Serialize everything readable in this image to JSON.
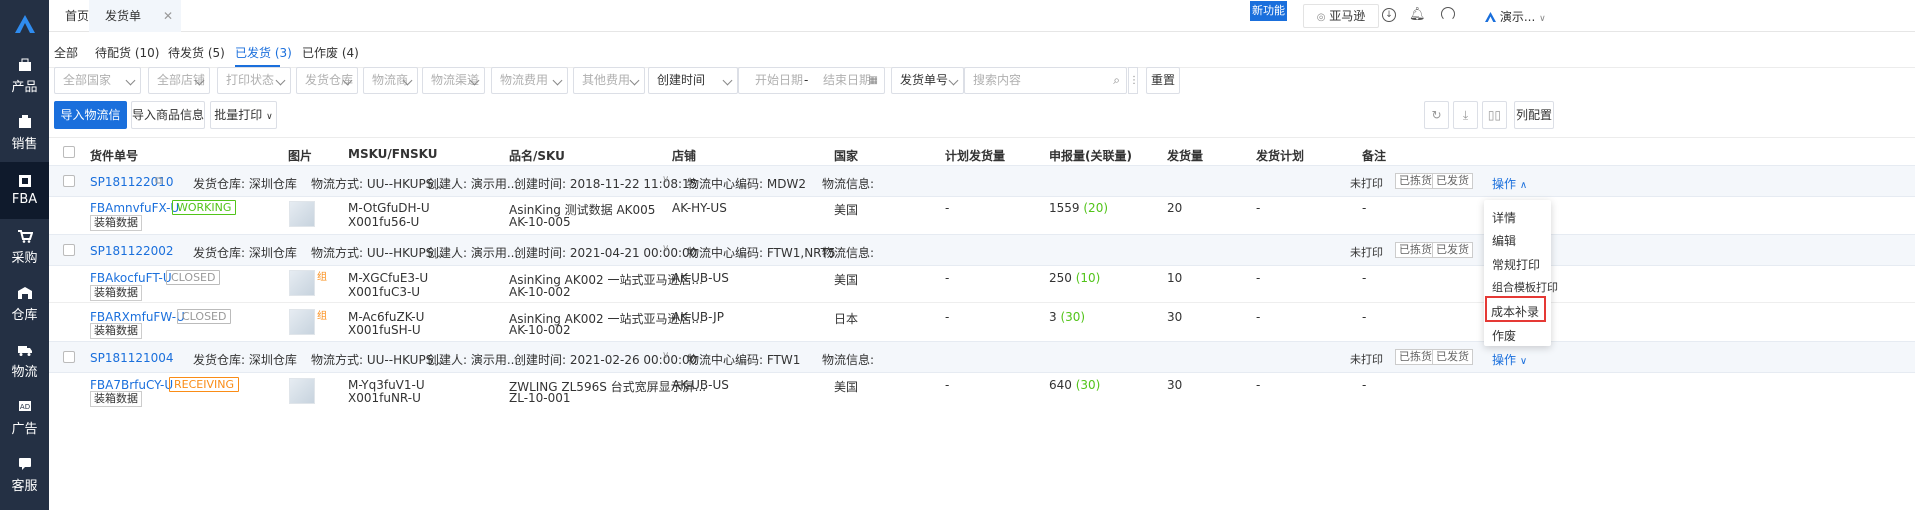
{
  "sidebar": {
    "items": [
      {
        "label": "产品",
        "icon": "product-icon"
      },
      {
        "label": "销售",
        "icon": "sales-icon"
      },
      {
        "label": "FBA",
        "icon": "fba-icon"
      },
      {
        "label": "采购",
        "icon": "purchase-icon"
      },
      {
        "label": "仓库",
        "icon": "warehouse-icon"
      },
      {
        "label": "物流",
        "icon": "logistics-icon"
      },
      {
        "label": "广告",
        "icon": "ads-icon"
      },
      {
        "label": "客服",
        "icon": "service-icon"
      }
    ]
  },
  "topbar": {
    "tabs": [
      "首页",
      "发货单"
    ],
    "new_feature": "新功能",
    "platform": "亚马逊",
    "account": "演示..."
  },
  "subtabs": [
    "全部",
    "待配货 (10)",
    "待发货 (5)",
    "已发货 (3)",
    "已作废 (4)"
  ],
  "filters": {
    "country": "全部国家",
    "shop": "全部店铺",
    "print_status": "打印状态",
    "warehouse": "发货仓库",
    "carrier": "物流商",
    "channel": "物流渠道",
    "logistics_fee": "物流费用",
    "other_fee": "其他费用",
    "time_type": "创建时间",
    "start_date": "开始日期",
    "end_date": "结束日期",
    "date_sep": "-",
    "search_type": "发货单号",
    "search_placeholder": "搜索内容",
    "reset": "重置"
  },
  "actions": {
    "import_logistics": "导入物流信息",
    "import_product": "导入商品信息",
    "batch_print": "批量打印",
    "column_config": "列配置"
  },
  "columns": [
    "货件单号",
    "图片",
    "MSKU/FNSKU",
    "品名/SKU",
    "店铺",
    "国家",
    "计划发货量",
    "申报量(关联量)",
    "发货量",
    "发货计划",
    "备注"
  ],
  "groups": [
    {
      "id": "SP181122010",
      "warehouse": "发货仓库: 深圳仓库",
      "method": "物流方式: UU--HKUPS...",
      "creator": "创建人: 演示用...",
      "created": "创建时间: 2018-11-22 11:08:15",
      "center": "物流中心编码: MDW2",
      "info": "物流信息:",
      "print": "未打印",
      "tag1": "已拣货",
      "tag2": "已发货",
      "op": "操作"
    },
    {
      "id": "SP181122002",
      "warehouse": "发货仓库: 深圳仓库",
      "method": "物流方式: UU--HKUPS...",
      "creator": "创建人: 演示用...",
      "created": "创建时间: 2021-04-21 00:00:00",
      "center": "物流中心编码: FTW1,NRT5",
      "info": "物流信息:",
      "print": "未打印",
      "tag1": "已拣货",
      "tag2": "已发货"
    },
    {
      "id": "SP181121004",
      "warehouse": "发货仓库: 深圳仓库",
      "method": "物流方式: UU--HKUPS...",
      "creator": "创建人: 演示用...",
      "created": "创建时间: 2021-02-26 00:00:00",
      "center": "物流中心编码: FTW1",
      "info": "物流信息:",
      "print": "未打印",
      "tag1": "已拣货",
      "tag2": "已发货",
      "op": "操作"
    }
  ],
  "rows": [
    {
      "shipment": "FBAmnvfuFX-U",
      "status": "WORKING",
      "status_color": "#52c41a",
      "btn": "装箱数据",
      "msku": "M-OtGfuDH-U",
      "fnsku": "X001fu56-U",
      "name": "AsinKing 测试数据 AK005",
      "sku": "AK-10-005",
      "shop": "AK-HY-US",
      "country": "美国",
      "plan": "-",
      "declared": "1559",
      "linked": "(20)",
      "qty": "20",
      "shipplan": "-",
      "note": "-"
    },
    {
      "shipment": "FBAkocfuFT-U",
      "status": "CLOSED",
      "status_color": "#999999",
      "btn": "装箱数据",
      "combo": "组",
      "msku": "M-XGCfuE3-U",
      "fnsku": "X001fuC3-U",
      "name": "AsinKing AK002 一站式亚马逊店...",
      "sku": "AK-10-002",
      "shop": "AK-UB-US",
      "country": "美国",
      "plan": "-",
      "declared": "250",
      "linked": "(10)",
      "qty": "10",
      "shipplan": "-",
      "note": "-"
    },
    {
      "shipment": "FBARXmfuFW-U",
      "status": "CLOSED",
      "status_color": "#999999",
      "btn": "装箱数据",
      "combo": "组",
      "msku": "M-Ac6fuZK-U",
      "fnsku": "X001fuSH-U",
      "name": "AsinKing AK002 一站式亚马逊店...",
      "sku": "AK-10-002",
      "shop": "AK-UB-JP",
      "country": "日本",
      "plan": "-",
      "declared": "3",
      "linked": "(30)",
      "qty": "30",
      "shipplan": "-",
      "note": "-"
    },
    {
      "shipment": "FBA7BrfuCY-U",
      "status": "RECEIVING",
      "status_color": "#fa8c16",
      "btn": "装箱数据",
      "msku": "M-Yq3fuV1-U",
      "fnsku": "X001fuNR-U",
      "name": "ZWLING ZL596S 台式宽屏显示屏...",
      "sku": "ZL-10-001",
      "shop": "AK-UB-US",
      "country": "美国",
      "plan": "-",
      "declared": "640",
      "linked": "(30)",
      "qty": "30",
      "shipplan": "-",
      "note": "-"
    }
  ],
  "dropdown": [
    "详情",
    "编辑",
    "常规打印",
    "组合模板打印",
    "成本补录",
    "作废"
  ]
}
